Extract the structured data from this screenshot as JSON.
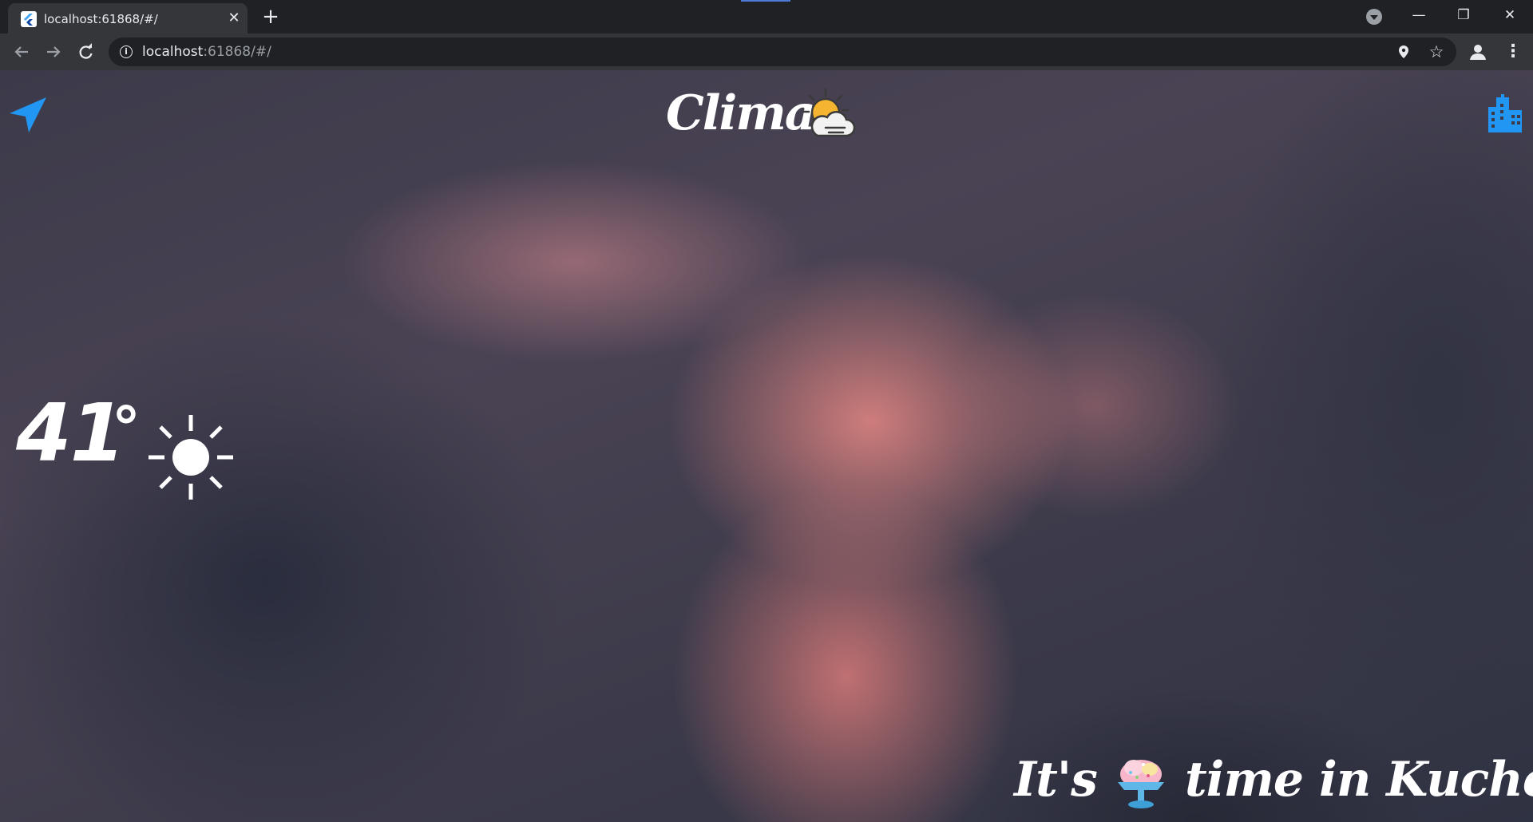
{
  "browser": {
    "tab_title": "localhost:61868/#/",
    "tab_close_glyph": "✕",
    "new_tab_glyph": "+",
    "window_controls": {
      "minimize": "—",
      "maximize": "❐",
      "close": "✕"
    },
    "url_host": "localhost",
    "url_rest": ":61868/#/",
    "icons": [
      "flutter-favicon-icon",
      "tab-search-icon",
      "back-arrow-icon",
      "forward-arrow-icon",
      "reload-icon",
      "site-info-icon",
      "location-pin-icon",
      "bookmark-star-icon",
      "profile-icon",
      "more-menu-icon"
    ]
  },
  "app": {
    "title": "Clima",
    "title_icon": "sun-behind-cloud-icon",
    "temperature": "41",
    "degree_symbol": "°",
    "condition_icon": "sun-icon",
    "message_prefix": "It's",
    "message_icon": "ice-cream-icon",
    "message_suffix": "time in Kuchera",
    "left_button_icon": "location-arrow-icon",
    "right_button_icon": "city-icon",
    "accent_color": "#2196f3"
  }
}
